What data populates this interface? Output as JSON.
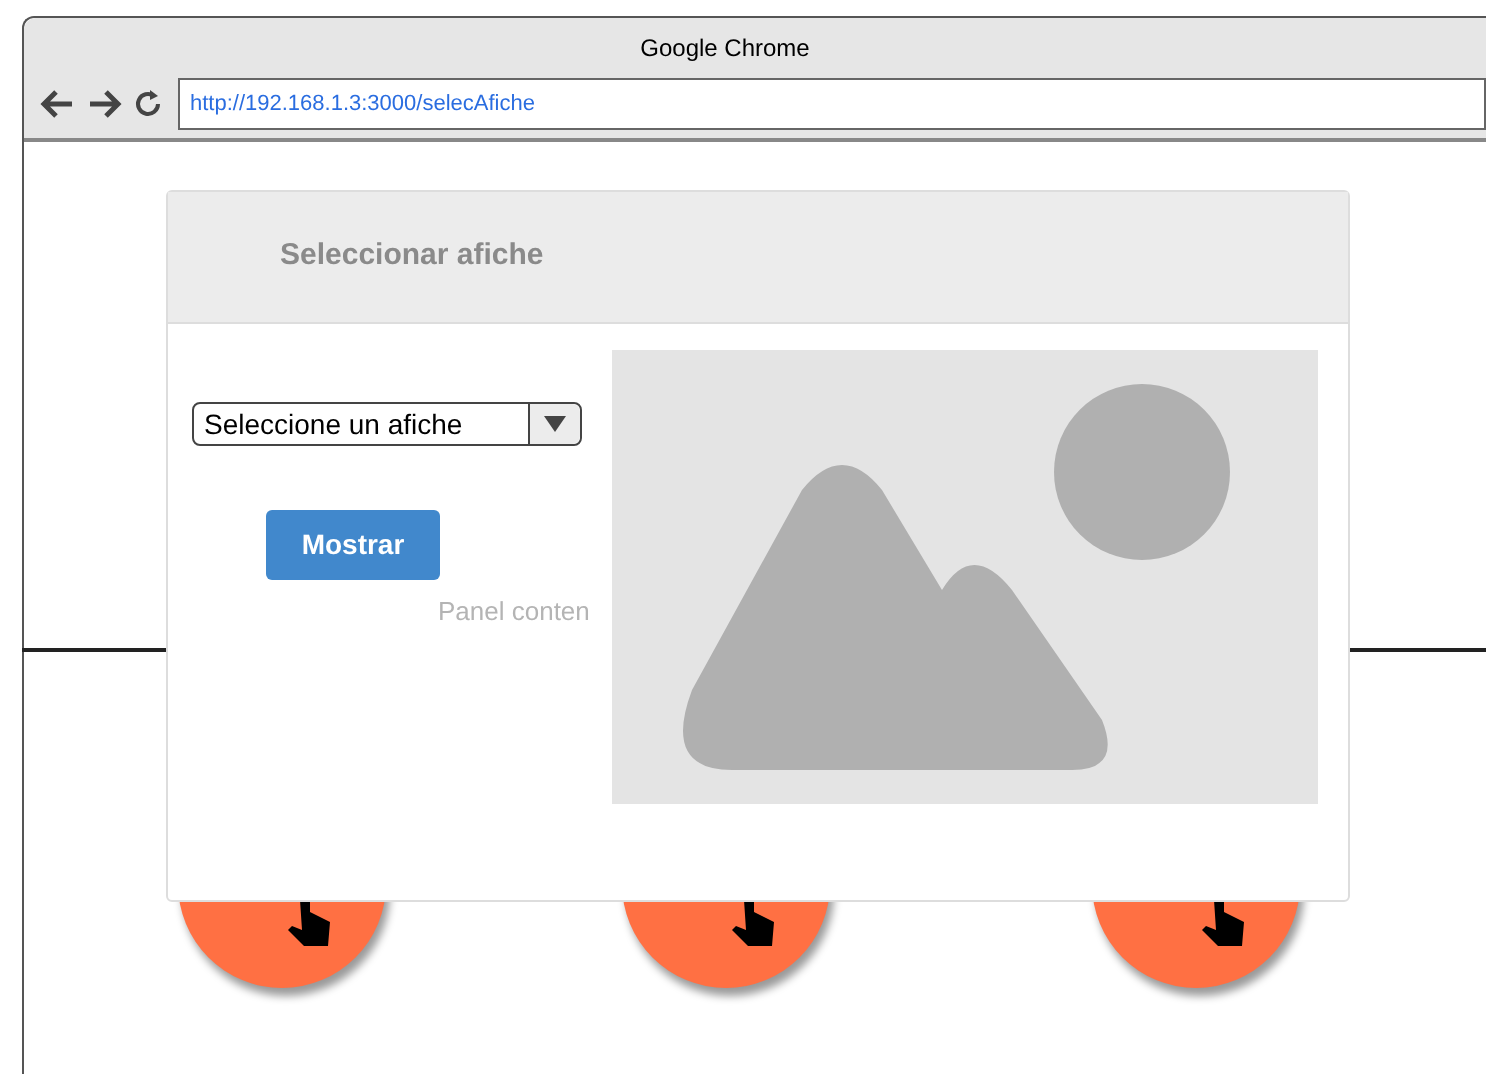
{
  "window": {
    "title": "Google Chrome",
    "url": "http://192.168.1.3:3000/selecAfiche"
  },
  "modal": {
    "title": "Seleccionar afiche",
    "select": {
      "value": "Seleccione un afiche"
    },
    "button": "Mostrar",
    "panel_text": "Panel conten"
  },
  "background_buttons": [
    {
      "kind": "circle"
    },
    {
      "kind": "circle"
    },
    {
      "kind": "circle"
    }
  ]
}
